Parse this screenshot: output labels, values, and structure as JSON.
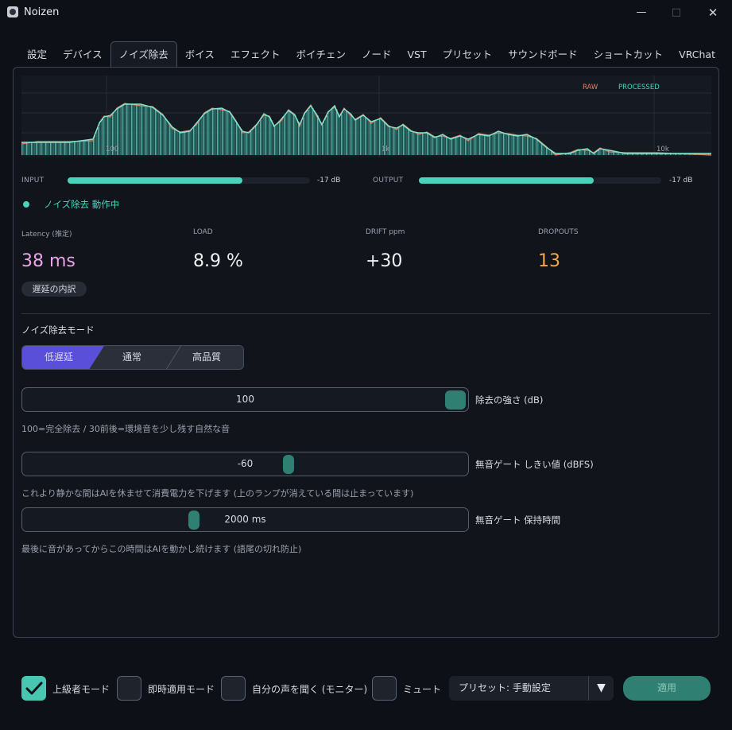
{
  "window": {
    "title": "Noizen",
    "minimize": "—",
    "maximize": "□",
    "close": "✕"
  },
  "tabs": [
    {
      "label": "設定"
    },
    {
      "label": "デバイス"
    },
    {
      "label": "ノイズ除去"
    },
    {
      "label": "ボイス"
    },
    {
      "label": "エフェクト"
    },
    {
      "label": "ボイチェン"
    },
    {
      "label": "ノード"
    },
    {
      "label": "VST"
    },
    {
      "label": "プリセット"
    },
    {
      "label": "サウンドボード"
    },
    {
      "label": "ショートカット"
    },
    {
      "label": "VRChat"
    }
  ],
  "active_tab": 2,
  "spectrum": {
    "legend_raw": "RAW",
    "legend_processed": "PROCESSED",
    "freq_labels": [
      "100",
      "1k",
      "10k"
    ],
    "raw_color": "#d9875f",
    "processed_color": "#47d4bd"
  },
  "meters": {
    "input_label": "INPUT",
    "input_level": 0.72,
    "input_db": "-17 dB",
    "output_label": "OUTPUT",
    "output_level": 0.72,
    "output_db": "-17 dB"
  },
  "status": {
    "text": "ノイズ除去 動作中"
  },
  "stats": {
    "latency_label": "Latency (推定)",
    "latency_value": "38 ms",
    "load_label": "LOAD",
    "load_value": "8.9 %",
    "drift_label": "DRIFT ppm",
    "drift_value": "+30",
    "dropouts_label": "DROPOUTS",
    "dropouts_value": "13",
    "breakdown_button": "遅延の内訳"
  },
  "mode": {
    "title": "ノイズ除去モード",
    "options": [
      "低遅延",
      "通常",
      "高品質"
    ],
    "selected": "低遅延"
  },
  "sliders": {
    "strength": {
      "value": "100",
      "label": "除去の強さ (dB)",
      "hint": "100=完全除去 / 30前後=環境音を少し残す自然な音",
      "position": 1.0
    },
    "gate_threshold": {
      "value": "-60",
      "label": "無音ゲート しきい値 (dBFS)",
      "hint": "これより静かな間はAIを休ませて消費電力を下げます (上のランプが消えている間は止まっています)",
      "position": 0.6
    },
    "gate_hold": {
      "value": "2000 ms",
      "label": "無音ゲート 保持時間",
      "hint": "最後に音があってからこの時間はAIを動かし続けます (語尾の切れ防止)",
      "position": 0.38
    }
  },
  "bottom": {
    "advanced_mode": {
      "label": "上級者モード",
      "checked": true
    },
    "instant_apply": {
      "label": "即時適用モード",
      "checked": false
    },
    "monitor": {
      "label": "自分の声を聞く (モニター)",
      "checked": false
    },
    "mute": {
      "label": "ミュート",
      "checked": false
    },
    "preset_text": "プリセット: 手動設定",
    "preset_arrow": "▼",
    "apply": "適用"
  },
  "colors": {
    "accent": "#47d4bd",
    "mode_active": "#5a4fd8",
    "latency": "#e9a6e6",
    "dropouts": "#f3a64a",
    "thumb": "#2f7f72"
  }
}
